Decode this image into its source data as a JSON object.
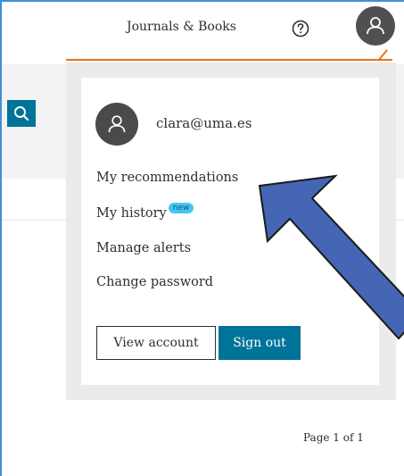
{
  "header": {
    "nav_link": "Journals & Books"
  },
  "account_menu": {
    "email": "clara@uma.es",
    "items": [
      {
        "label": "My recommendations"
      },
      {
        "label": "My history",
        "badge": "new"
      },
      {
        "label": "Manage alerts"
      },
      {
        "label": "Change password"
      }
    ],
    "view_account_label": "View account",
    "sign_out_label": "Sign out"
  },
  "pagination": {
    "label": "Page 1 of 1"
  },
  "colors": {
    "accent_orange": "#e9711c",
    "primary_blue": "#007398",
    "annotation_arrow": "#4466b4",
    "badge_blue": "#44c6f4"
  },
  "icons": [
    "help-icon",
    "user-icon",
    "search-icon"
  ]
}
